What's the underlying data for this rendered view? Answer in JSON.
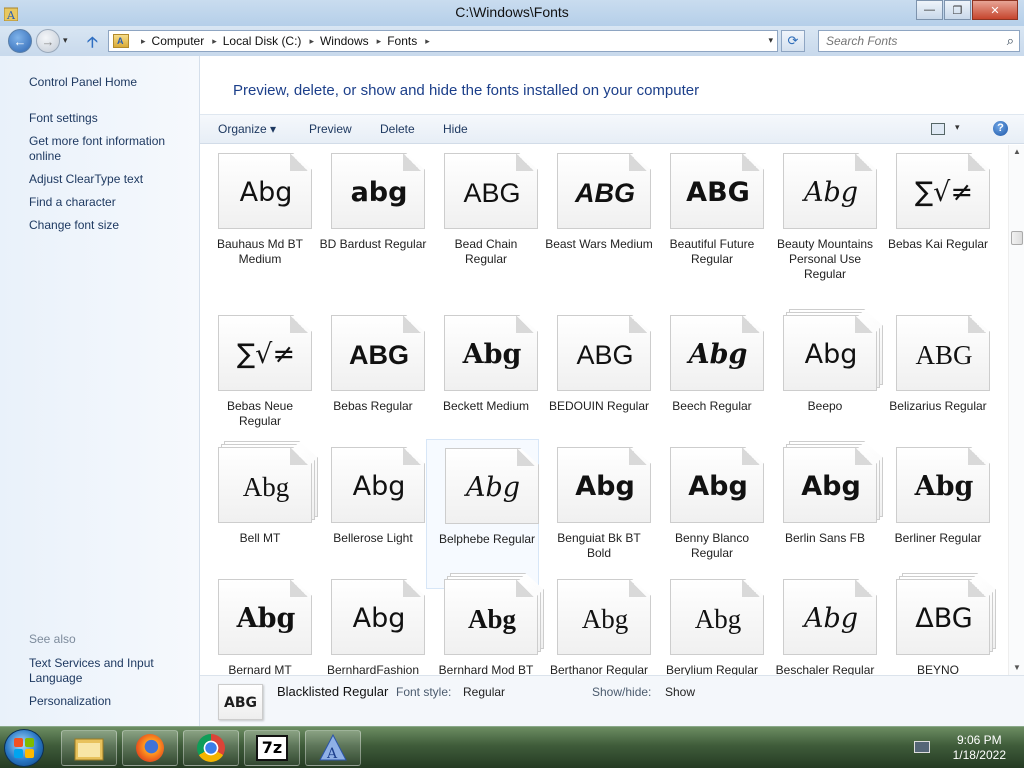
{
  "window": {
    "title": "C:\\Windows\\Fonts",
    "buttons": {
      "minimize": "—",
      "maximize": "❐",
      "close": "✕"
    }
  },
  "navigation": {
    "back_icon": "←",
    "forward_icon": "→",
    "dropdown_icon": "▾",
    "up_icon": "🡡",
    "breadcrumb": [
      "Computer",
      "Local Disk (C:)",
      "Windows",
      "Fonts"
    ],
    "breadcrumb_separator": "▸",
    "refresh_icon": "⟳",
    "search_placeholder": "Search Fonts",
    "search_icon": "⌕"
  },
  "sidebar": {
    "items": [
      {
        "label": "Control Panel Home"
      },
      {
        "label": "Font settings"
      },
      {
        "label": "Get more font information online"
      },
      {
        "label": "Adjust ClearType text"
      },
      {
        "label": "Find a character"
      },
      {
        "label": "Change font size"
      }
    ],
    "see_also": "See also",
    "see_also_items": [
      {
        "label": "Text Services and Input Language"
      },
      {
        "label": "Personalization"
      }
    ]
  },
  "main": {
    "heading": "Preview, delete, or show and hide the fonts installed on your computer",
    "toolbar": {
      "organize": "Organize",
      "organize_arrow": "▾",
      "preview": "Preview",
      "delete": "Delete",
      "hide": "Hide",
      "view_dropdown": "▾",
      "help": "?"
    },
    "fonts": [
      {
        "name": "Bauhaus Md BT Medium",
        "sample": "Abg",
        "family": "\"DejaVu Sans\", sans-serif",
        "weight": "normal",
        "style": "normal",
        "stack": false
      },
      {
        "name": "BD Bardust Regular",
        "sample": "abg",
        "family": "\"DejaVu Sans\", sans-serif",
        "weight": "bold",
        "style": "normal",
        "stack": false
      },
      {
        "name": "Bead Chain Regular",
        "sample": "ABG",
        "family": "\"Liberation Sans\", sans-serif",
        "weight": "normal",
        "style": "normal",
        "stack": false
      },
      {
        "name": "Beast Wars Medium",
        "sample": "ABG",
        "family": "\"Liberation Sans\", sans-serif",
        "weight": "bold",
        "style": "italic",
        "stack": false
      },
      {
        "name": "Beautiful Future Regular",
        "sample": "ABG",
        "family": "\"DejaVu Sans\", sans-serif",
        "weight": "bold",
        "style": "normal",
        "stack": false
      },
      {
        "name": "Beauty Mountains Personal Use Regular",
        "sample": "Abg",
        "family": "\"DejaVu Serif\", serif",
        "weight": "normal",
        "style": "italic",
        "stack": false
      },
      {
        "name": "Bebas Kai Regular",
        "sample": "∑√≠",
        "family": "\"DejaVu Sans\", sans-serif",
        "weight": "normal",
        "style": "normal",
        "stack": false
      },
      {
        "name": "Bebas Neue Regular",
        "sample": "∑√≠",
        "family": "\"DejaVu Sans\", sans-serif",
        "weight": "normal",
        "style": "normal",
        "stack": false
      },
      {
        "name": "Bebas Regular",
        "sample": "ABG",
        "family": "\"Liberation Sans\", sans-serif",
        "weight": "bold",
        "style": "normal",
        "stack": false
      },
      {
        "name": "Beckett Medium",
        "sample": "Abg",
        "family": "\"DejaVu Serif\", serif",
        "weight": "bold",
        "style": "normal",
        "stack": false
      },
      {
        "name": "BEDOUIN Regular",
        "sample": "ABG",
        "family": "\"Liberation Sans\", sans-serif",
        "weight": "normal",
        "style": "normal",
        "stack": false
      },
      {
        "name": "Beech Regular",
        "sample": "Abg",
        "family": "\"DejaVu Serif\", serif",
        "weight": "bold",
        "style": "italic",
        "stack": false
      },
      {
        "name": "Beepo",
        "sample": "Abg",
        "family": "\"DejaVu Sans\", sans-serif",
        "weight": "normal",
        "style": "normal",
        "stack": true
      },
      {
        "name": "Belizarius Regular",
        "sample": "ABG",
        "family": "\"Liberation Serif\", serif",
        "weight": "normal",
        "style": "normal",
        "stack": false
      },
      {
        "name": "Bell MT",
        "sample": "Abg",
        "family": "\"Liberation Serif\", serif",
        "weight": "normal",
        "style": "normal",
        "stack": true
      },
      {
        "name": "Bellerose Light",
        "sample": "Abg",
        "family": "\"DejaVu Sans\", sans-serif",
        "weight": "normal",
        "style": "normal",
        "stack": false
      },
      {
        "name": "Belphebe Regular",
        "sample": "Abg",
        "family": "\"DejaVu Serif\", serif",
        "weight": "normal",
        "style": "italic",
        "stack": false
      },
      {
        "name": "Benguiat Bk BT Bold",
        "sample": "Abg",
        "family": "\"DejaVu Sans\", sans-serif",
        "weight": "bold",
        "style": "normal",
        "stack": false
      },
      {
        "name": "Benny Blanco Regular",
        "sample": "Abg",
        "family": "\"DejaVu Sans\", sans-serif",
        "weight": "bold",
        "style": "normal",
        "stack": false
      },
      {
        "name": "Berlin Sans FB",
        "sample": "Abg",
        "family": "\"DejaVu Sans\", sans-serif",
        "weight": "bold",
        "style": "normal",
        "stack": true
      },
      {
        "name": "Berliner Regular",
        "sample": "Abg",
        "family": "\"DejaVu Serif\", serif",
        "weight": "bold",
        "style": "normal",
        "stack": false
      },
      {
        "name": "Bernard MT",
        "sample": "Abg",
        "family": "\"DejaVu Serif\", serif",
        "weight": "bold",
        "style": "normal",
        "stack": false
      },
      {
        "name": "BernhardFashion",
        "sample": "Abg",
        "family": "\"DejaVu Sans\", sans-serif",
        "weight": "normal",
        "style": "normal",
        "stack": false
      },
      {
        "name": "Bernhard Mod BT",
        "sample": "Abg",
        "family": "\"Liberation Serif\", serif",
        "weight": "bold",
        "style": "normal",
        "stack": true
      },
      {
        "name": "Berthanor Regular",
        "sample": "Abg",
        "family": "\"Liberation Serif\", serif",
        "weight": "normal",
        "style": "normal",
        "stack": false
      },
      {
        "name": "Berylium Regular",
        "sample": "Abg",
        "family": "\"Liberation Serif\", serif",
        "weight": "normal",
        "style": "normal",
        "stack": false
      },
      {
        "name": "Beschaler Regular",
        "sample": "Abg",
        "family": "\"DejaVu Serif\", serif",
        "weight": "normal",
        "style": "italic",
        "stack": false
      },
      {
        "name": "BEYNO",
        "sample": "ΔBG",
        "family": "\"DejaVu Sans\", sans-serif",
        "weight": "normal",
        "style": "normal",
        "stack": true
      }
    ],
    "hovered_font": "Belphebe Regular"
  },
  "details": {
    "preview": "ABG",
    "name": "Blacklisted Regular",
    "font_style_label": "Font style:",
    "font_style_value": "Regular",
    "show_hide_label": "Show/hide:",
    "show_hide_value": "Show"
  },
  "taskbar": {
    "apps": [
      "file-explorer",
      "firefox",
      "chrome",
      "7-zip",
      "font-app"
    ],
    "seven_zip_label": "7z",
    "time": "9:06 PM",
    "date": "1/18/2022"
  }
}
